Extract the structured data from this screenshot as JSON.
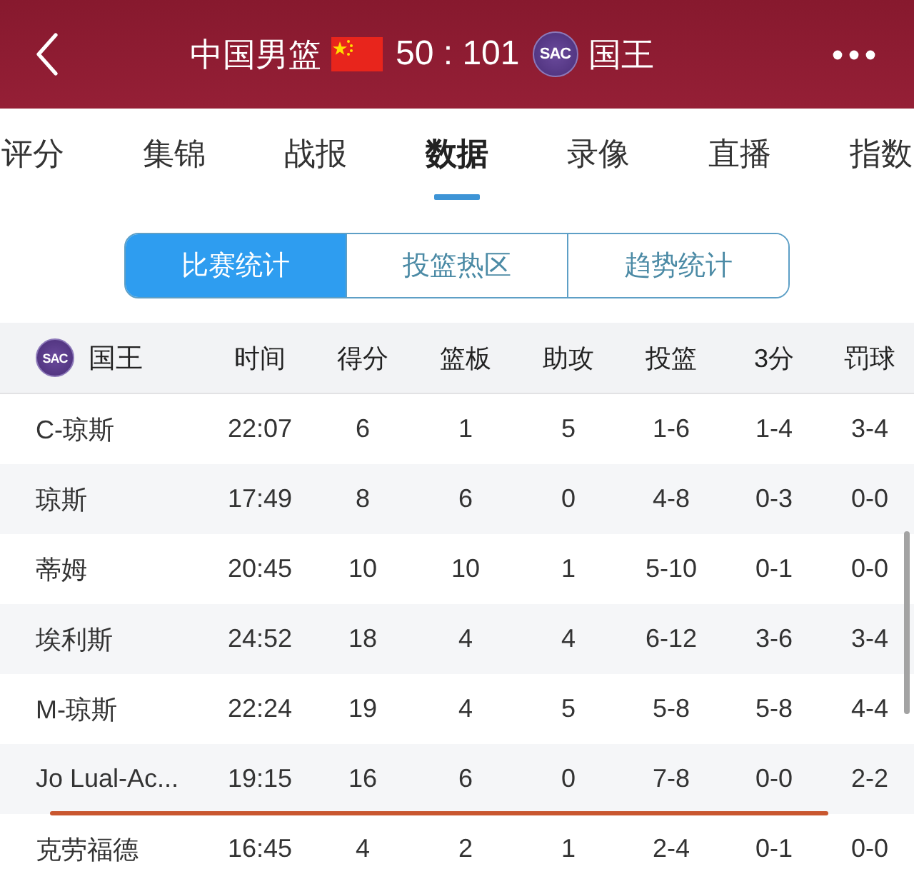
{
  "header": {
    "home_team": "中国男篮",
    "score": "50 : 101",
    "away_logo": "SAC",
    "away_team": "国王"
  },
  "tabs": [
    {
      "label": "评分",
      "selected": false
    },
    {
      "label": "集锦",
      "selected": false
    },
    {
      "label": "战报",
      "selected": false
    },
    {
      "label": "数据",
      "selected": true
    },
    {
      "label": "录像",
      "selected": false
    },
    {
      "label": "直播",
      "selected": false
    },
    {
      "label": "指数",
      "selected": false
    }
  ],
  "segments": [
    {
      "label": "比赛统计",
      "selected": true
    },
    {
      "label": "投篮热区",
      "selected": false
    },
    {
      "label": "趋势统计",
      "selected": false
    }
  ],
  "table": {
    "team_logo": "SAC",
    "team": "国王",
    "columns": [
      "时间",
      "得分",
      "篮板",
      "助攻",
      "投篮",
      "3分",
      "罚球"
    ],
    "rows": [
      {
        "name": "C-琼斯",
        "cells": [
          "22:07",
          "6",
          "1",
          "5",
          "1-6",
          "1-4",
          "3-4"
        ],
        "underlined": false
      },
      {
        "name": "琼斯",
        "cells": [
          "17:49",
          "8",
          "6",
          "0",
          "4-8",
          "0-3",
          "0-0"
        ],
        "underlined": false
      },
      {
        "name": "蒂姆",
        "cells": [
          "20:45",
          "10",
          "10",
          "1",
          "5-10",
          "0-1",
          "0-0"
        ],
        "underlined": false
      },
      {
        "name": "埃利斯",
        "cells": [
          "24:52",
          "18",
          "4",
          "4",
          "6-12",
          "3-6",
          "3-4"
        ],
        "underlined": false
      },
      {
        "name": "M-琼斯",
        "cells": [
          "22:24",
          "19",
          "4",
          "5",
          "5-8",
          "5-8",
          "4-4"
        ],
        "underlined": false
      },
      {
        "name": "Jo Lual-Ac...",
        "cells": [
          "19:15",
          "16",
          "6",
          "0",
          "7-8",
          "0-0",
          "2-2"
        ],
        "underlined": true
      },
      {
        "name": "克劳福德",
        "cells": [
          "16:45",
          "4",
          "2",
          "1",
          "2-4",
          "0-1",
          "0-0"
        ],
        "underlined": false
      }
    ]
  }
}
